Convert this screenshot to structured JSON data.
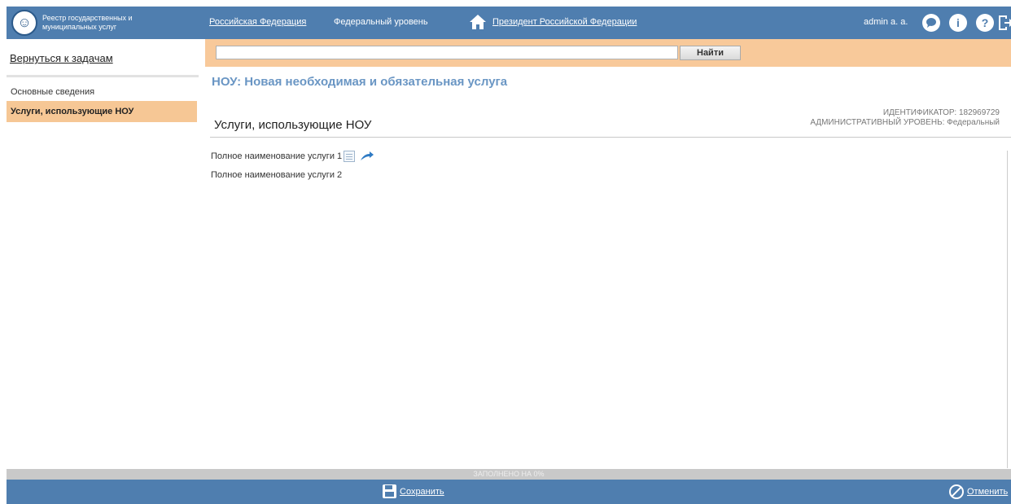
{
  "header": {
    "logo_line1": "Реестр государственных и",
    "logo_line2": "муниципальных услуг",
    "nav_federation": "Российская Федерация",
    "nav_level": "Федеральный уровень",
    "nav_president": "Президент Российской Федерации",
    "user": "admin a. a.",
    "icons": [
      "chat-icon",
      "info-icon",
      "help-icon",
      "logout-icon",
      "home-icon"
    ]
  },
  "sidebar": {
    "back_link": "Вернуться к задачам",
    "items": [
      {
        "label": "Основные сведения",
        "active": false
      },
      {
        "label": "Услуги, использующие НОУ",
        "active": true
      }
    ]
  },
  "search": {
    "value": "",
    "placeholder": "",
    "button_label": "Найти"
  },
  "main": {
    "title": "НОУ: Новая необходимая и обязательная услуга",
    "section_title": "Услуги, использующие НОУ",
    "identifier": "ИДЕНТИФИКАТОР: 182969729",
    "admin_level": "АДМИНИСТРАТИВНЫЙ УРОВЕНЬ: Федеральный",
    "services": [
      {
        "name": "Полное наименование услуги 1"
      },
      {
        "name": "Полное наименование услуги 2"
      }
    ]
  },
  "progress": {
    "label": "ЗАПОЛНЕНО НА 0%",
    "percent": 0
  },
  "footer": {
    "save_label": "Сохранить",
    "cancel_label": "Отменить"
  },
  "colors": {
    "header_blue": "#4f7eaf",
    "accent_orange": "#f8c99a",
    "title_blue": "#6a96c4"
  }
}
